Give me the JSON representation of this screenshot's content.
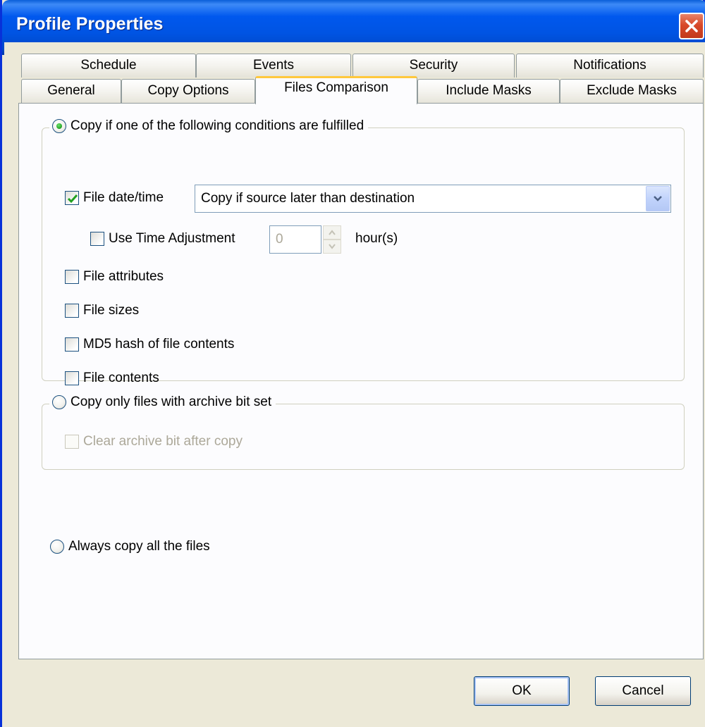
{
  "window": {
    "title": "Profile Properties"
  },
  "tabs": {
    "row_back": [
      "Schedule",
      "Events",
      "Security",
      "Notifications"
    ],
    "row_front": [
      "General",
      "Copy Options",
      "Files Comparison",
      "Include Masks",
      "Exclude Masks"
    ],
    "active": "Files Comparison"
  },
  "conditions": {
    "radio_label": "Copy if one of the following conditions are fulfilled",
    "radio_selected": true,
    "file_datetime": {
      "label": "File date/time",
      "checked": true
    },
    "datetime_mode": {
      "value": "Copy if source later than destination"
    },
    "time_adjustment": {
      "label": "Use Time Adjustment",
      "checked": false,
      "value": "0",
      "unit": "hour(s)"
    },
    "file_attributes": {
      "label": "File attributes",
      "checked": false
    },
    "file_sizes": {
      "label": "File sizes",
      "checked": false
    },
    "md5_hash": {
      "label": "MD5 hash of file contents",
      "checked": false
    },
    "file_contents": {
      "label": "File contents",
      "checked": false
    }
  },
  "archive": {
    "radio_label": "Copy only files with archive bit set",
    "radio_selected": false,
    "clear_bit": {
      "label": "Clear archive bit after copy",
      "checked": false,
      "enabled": false
    }
  },
  "always": {
    "radio_label": "Always copy all the files",
    "radio_selected": false
  },
  "buttons": {
    "ok": "OK",
    "cancel": "Cancel"
  },
  "colors": {
    "titlebar": "#0054e3",
    "close": "#d8492a",
    "active_tab_accent": "#ffc83c",
    "check_mark": "#21a121"
  }
}
